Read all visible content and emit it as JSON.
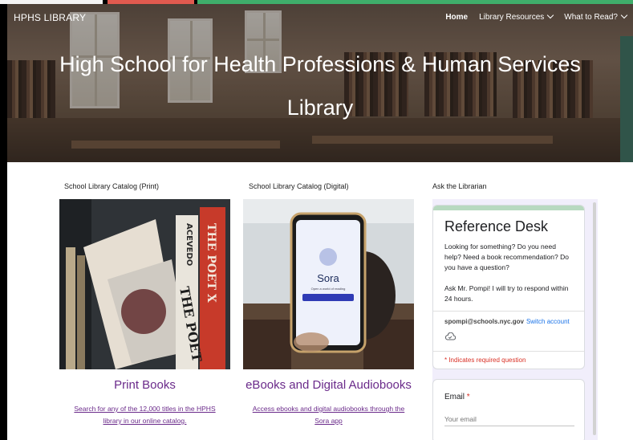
{
  "site": {
    "brand": "HPHS LIBRARY",
    "nav": [
      {
        "label": "Home",
        "active": true
      },
      {
        "label": "Library Resources",
        "dropdown": true
      },
      {
        "label": "What to Read?",
        "dropdown": true
      }
    ]
  },
  "hero": {
    "title_line1": "High School for Health Professions & Human Services",
    "title_line2": "Library"
  },
  "columns": {
    "print": {
      "label": "School Library Catalog (Print)",
      "title": "Print Books",
      "link_line1": "Search for any of the 12,000 titles in the HPHS",
      "link_line2": "library in our online catalog."
    },
    "digital": {
      "label": "School Library Catalog (Digital)",
      "title": "eBooks and Digital Audiobooks",
      "link_line1": "Access ebooks and digital audiobooks through the",
      "link_line2": "Sora app"
    },
    "ask": {
      "label": "Ask the Librarian"
    }
  },
  "form": {
    "title": "Reference Desk",
    "desc1": "Looking for something?  Do you need help? Need a book recommendation?  Do you have a question?",
    "desc2": "Ask Mr. Pompi! I will try to respond within 24 hours.",
    "account_email": "spompi@schools.nyc.gov",
    "switch_account": "Switch account",
    "required_note": "* Indicates required question",
    "email_label": "Email",
    "email_required_marker": "*",
    "email_placeholder": "Your email"
  },
  "book_covers": {
    "spine_1": "ACEVEDO",
    "spine_2": "THE POET",
    "cover_title": "THE POET X"
  },
  "phone_screen": {
    "app_name": "Sora",
    "tagline": "Open a world of reading"
  },
  "colors": {
    "link_purple": "#6a2a8a",
    "form_accent": "#b8d9c0",
    "required_red": "#d93025",
    "switch_blue": "#1a73e8",
    "form_bg": "#f1eefb"
  }
}
